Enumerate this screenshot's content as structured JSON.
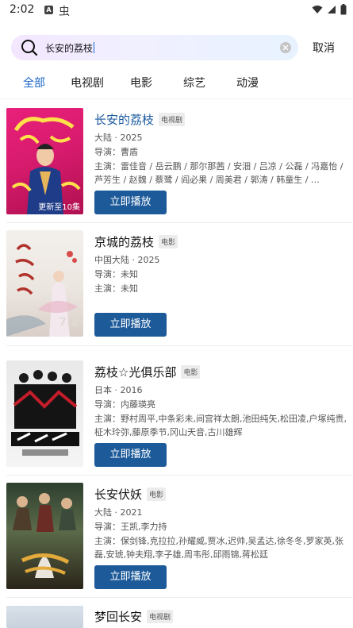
{
  "status_bar": {
    "time": "2:02",
    "icon_a": "A",
    "icon_b": "虫"
  },
  "search": {
    "query": "长安的荔枝",
    "cancel_label": "取消"
  },
  "tabs": [
    {
      "label": "全部"
    },
    {
      "label": "电视剧"
    },
    {
      "label": "电影"
    },
    {
      "label": "综艺"
    },
    {
      "label": "动漫"
    }
  ],
  "results": [
    {
      "title": "长安的荔枝",
      "type": "电视剧",
      "region_year": "大陆 · 2025",
      "director": "导演：曹盾",
      "cast": "主演：雷佳音 / 岳云鹏 / 那尔那茜 / 安沺 / 吕凉 / 公磊 / 冯嘉怡 / 芦芳生 / 赵魏 / 蔡鹭 / 阎必果 / 周美君 / 郭涛 / 韩童生 / …",
      "poster_badge": "更新至10集",
      "play_label": "立即播放"
    },
    {
      "title": "京城的荔枝",
      "type": "电影",
      "region_year": "中国大陆 · 2025",
      "director": "导演：未知",
      "cast": "主演：未知",
      "poster_badge": "7.2",
      "play_label": "立即播放"
    },
    {
      "title": "荔枝☆光俱乐部",
      "type": "电影",
      "region_year": "日本 · 2016",
      "director": "导演：内藤瑛亮",
      "cast": "主演：野村周平,中条彩未,间宫祥太朗,池田纯矢,松田凌,户塚纯贵,柾木玲弥,藤原季节,冈山天音,古川雄辉",
      "poster_badge": "",
      "play_label": "立即播放"
    },
    {
      "title": "长安伏妖",
      "type": "电影",
      "region_year": "大陆 · 2021",
      "director": "导演：王凯,李力持",
      "cast": "主演：保剑锋,克拉拉,孙耀威,贾冰,迟帅,吴孟达,徐冬冬,罗家英,张磊,安琥,钟夫翔,李子雄,周韦彤,邱雨锦,蒋松廷",
      "poster_badge": "",
      "play_label": "立即播放"
    },
    {
      "title": "梦回长安",
      "type": "电视剧"
    }
  ],
  "colors": {
    "accent": "#1a66c8",
    "button": "#1c5a99",
    "highlight_title": "#1a5a9e"
  }
}
